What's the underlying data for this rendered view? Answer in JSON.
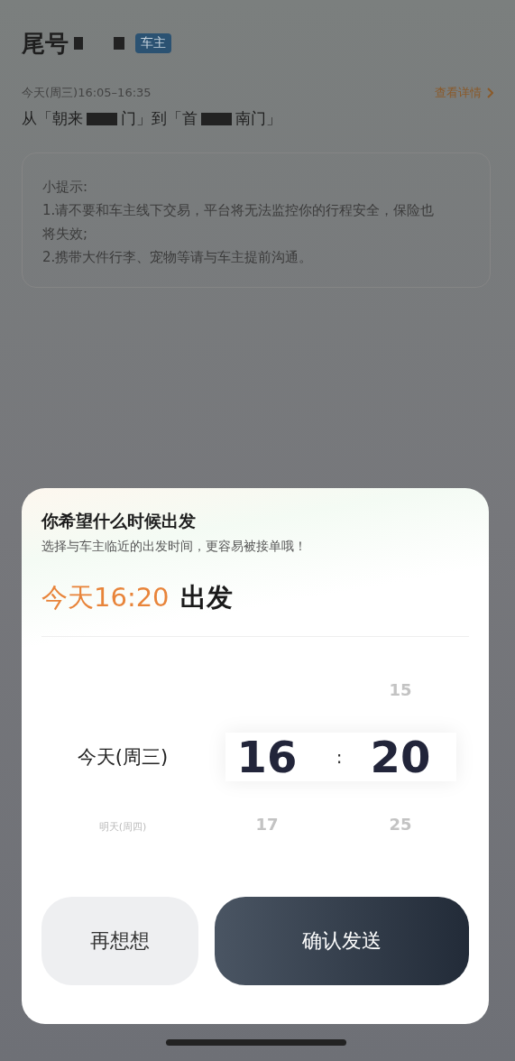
{
  "header": {
    "title": "尾号",
    "badge": "车主"
  },
  "trip": {
    "time": "今天(周三)16:05–16:35",
    "details_link": "查看详情",
    "route_parts": [
      "从「朝来",
      "门」到「首",
      "南门」"
    ]
  },
  "tips": [
    "小提示:",
    "1.请不要和车主线下交易，平台将无法监控你的行程安全，保险也将失效;",
    "2.携带大件行李、宠物等请与车主提前沟通。"
  ],
  "sheet": {
    "title": "你希望什么时候出发",
    "subtitle": "选择与车主临近的出发时间，更容易被接单哦！",
    "summary_time": "今天16:20",
    "summary_suffix": "出发",
    "separator": ":",
    "columns": [
      {
        "kind": "day",
        "items": [
          {
            "label": "今天(周三)",
            "selected": true
          },
          {
            "label": "明天(周四)",
            "selected": false
          }
        ]
      },
      {
        "kind": "hour",
        "items": [
          {
            "label": "16",
            "selected": true
          },
          {
            "label": "17",
            "selected": false
          }
        ]
      },
      {
        "kind": "minute",
        "items": [
          {
            "label": "15",
            "selected": false
          },
          {
            "label": "20",
            "selected": true
          },
          {
            "label": "25",
            "selected": false
          }
        ]
      }
    ],
    "buttons": [
      {
        "label": "再想想",
        "kind": "secondary"
      },
      {
        "label": "确认发送",
        "kind": "primary"
      }
    ]
  }
}
